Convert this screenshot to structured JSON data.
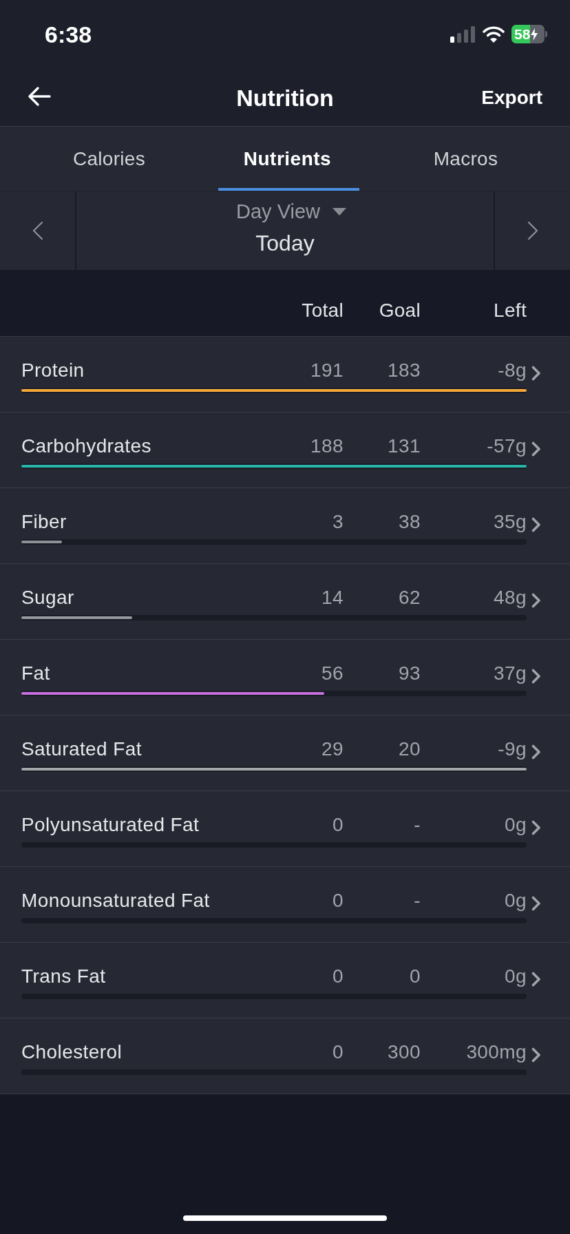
{
  "status_bar": {
    "time": "6:38",
    "battery": "58"
  },
  "nav": {
    "title": "Nutrition",
    "action": "Export"
  },
  "tabs": [
    {
      "label": "Calories",
      "selected": false
    },
    {
      "label": "Nutrients",
      "selected": true
    },
    {
      "label": "Macros",
      "selected": false
    }
  ],
  "date_navigator": {
    "view": "Day View",
    "date": "Today"
  },
  "table": {
    "columns": [
      "Total",
      "Goal",
      "Left"
    ],
    "rows": [
      {
        "name": "Protein",
        "total": "191",
        "goal": "183",
        "left": "-8g",
        "level": 1,
        "color": "#f5a83a"
      },
      {
        "name": "Carbohydrates",
        "total": "188",
        "goal": "131",
        "left": "-57g",
        "level": 1,
        "color": "#27b5a9"
      },
      {
        "name": "Fiber",
        "total": "3",
        "goal": "38",
        "left": "35g",
        "level": 0.08,
        "color": "#8e9096"
      },
      {
        "name": "Sugar",
        "total": "14",
        "goal": "62",
        "left": "48g",
        "level": 0.22,
        "color": "#96989e"
      },
      {
        "name": "Fat",
        "total": "56",
        "goal": "93",
        "left": "37g",
        "level": 0.6,
        "color": "#c86fe0"
      },
      {
        "name": "Saturated Fat",
        "total": "29",
        "goal": "20",
        "left": "-9g",
        "level": 1,
        "color": "#a4a6aa"
      },
      {
        "name": "Polyunsaturated Fat",
        "total": "0",
        "goal": "-",
        "left": "0g"
      },
      {
        "name": "Monounsaturated Fat",
        "total": "0",
        "goal": "-",
        "left": "0g"
      },
      {
        "name": "Trans Fat",
        "total": "0",
        "goal": "0",
        "left": "0g"
      },
      {
        "name": "Cholesterol",
        "total": "0",
        "goal": "300",
        "left": "300mg"
      }
    ]
  }
}
